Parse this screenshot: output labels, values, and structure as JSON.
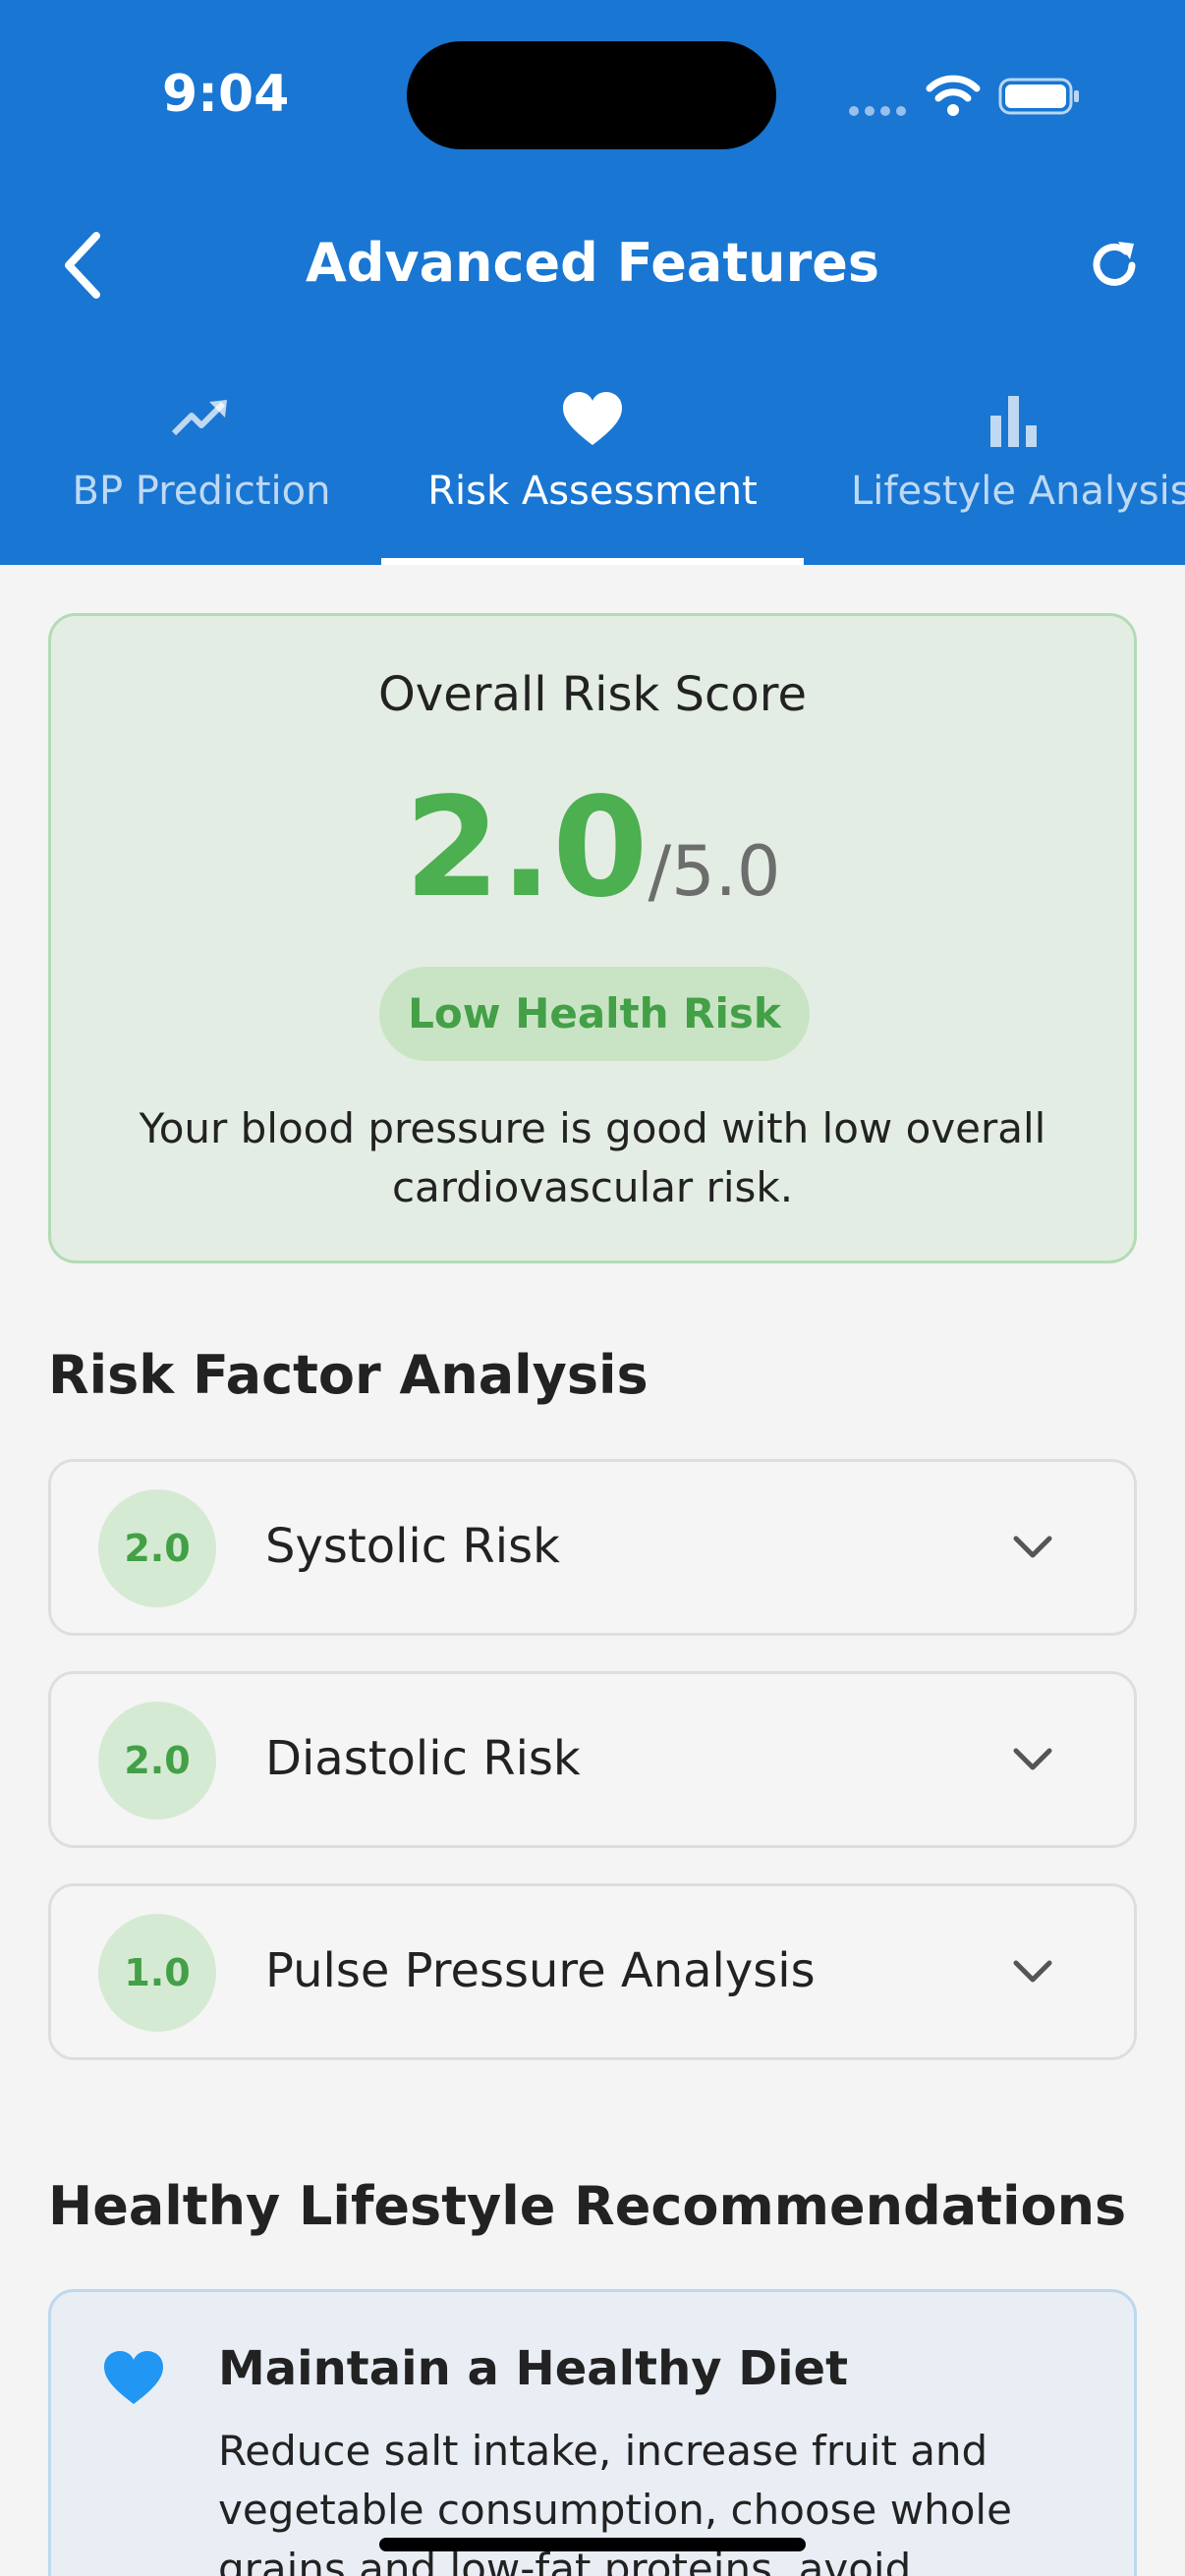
{
  "status_bar": {
    "time": "9:04"
  },
  "header": {
    "title": "Advanced Features"
  },
  "tabs": [
    {
      "label": "BP Prediction",
      "icon": "trending-up-icon",
      "active": false
    },
    {
      "label": "Risk Assessment",
      "icon": "heart-icon",
      "active": true
    },
    {
      "label": "Lifestyle Analysis",
      "icon": "bar-chart-icon",
      "active": false
    }
  ],
  "overall_risk": {
    "title": "Overall Risk Score",
    "score": "2.0",
    "max": "/5.0",
    "badge": "Low Health Risk",
    "description": "Your blood pressure is good with low overall cardiovascular risk."
  },
  "risk_factors": {
    "title": "Risk Factor Analysis",
    "items": [
      {
        "score": "2.0",
        "label": "Systolic Risk"
      },
      {
        "score": "2.0",
        "label": "Diastolic Risk"
      },
      {
        "score": "1.0",
        "label": "Pulse Pressure Analysis"
      }
    ]
  },
  "recommendations": {
    "title": "Healthy Lifestyle Recommendations",
    "items": [
      {
        "title": "Maintain a Healthy Diet",
        "text": "Reduce salt intake, increase fruit and vegetable consumption, choose whole grains and low-fat proteins, avoid"
      }
    ]
  },
  "colors": {
    "header_bg": "#1976d2",
    "accent_green": "#4caf50",
    "card_green_bg": "#e4ede3",
    "heart_blue": "#2196f3"
  }
}
